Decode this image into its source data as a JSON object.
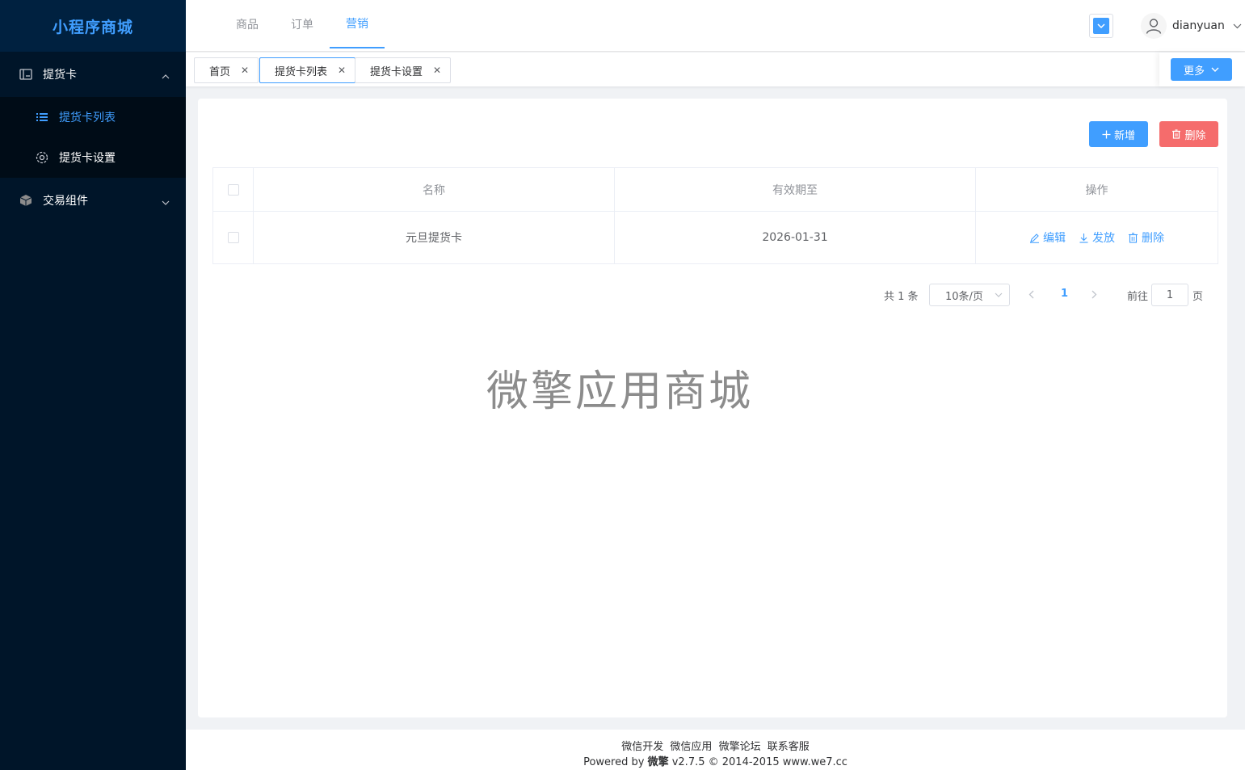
{
  "sidebar": {
    "logo": "小程序商城",
    "groups": [
      {
        "label": "提货卡",
        "icon": "card-icon",
        "expanded": true,
        "items": [
          {
            "label": "提货卡列表",
            "icon": "list-icon",
            "active": true
          },
          {
            "label": "提货卡设置",
            "icon": "gear-icon",
            "active": false
          }
        ]
      },
      {
        "label": "交易组件",
        "icon": "box-icon",
        "expanded": false
      }
    ]
  },
  "header": {
    "nav": [
      "商品",
      "订单",
      "营销"
    ],
    "active_nav": "营销",
    "username": "dianyuan"
  },
  "tabs": {
    "items": [
      {
        "label": "首页",
        "active": false
      },
      {
        "label": "提货卡列表",
        "active": true
      },
      {
        "label": "提货卡设置",
        "active": false
      }
    ],
    "more_label": "更多"
  },
  "toolbar": {
    "add_label": "新增",
    "delete_label": "删除"
  },
  "table": {
    "columns": [
      "名称",
      "有效期至",
      "操作"
    ],
    "rows": [
      {
        "name": "元旦提货卡",
        "expire": "2026-01-31"
      }
    ],
    "actions": [
      "编辑",
      "发放",
      "删除"
    ]
  },
  "pagination": {
    "total": "共 1 条",
    "page_size": "10条/页",
    "current_page": "1",
    "goto_prefix": "前往",
    "goto_value": "1",
    "goto_suffix": "页"
  },
  "watermark": "微擎应用商城",
  "footer": {
    "links": [
      "微信开发",
      "微信应用",
      "微擎论坛",
      "联系客服"
    ],
    "powered_prefix": "Powered by",
    "brand": "微擎",
    "version_text": "v2.7.5 © 2014-2015 www.we7.cc"
  },
  "colors": {
    "primary": "#409eff",
    "danger": "#f56c6c",
    "sidebar_bg": "#001529"
  }
}
